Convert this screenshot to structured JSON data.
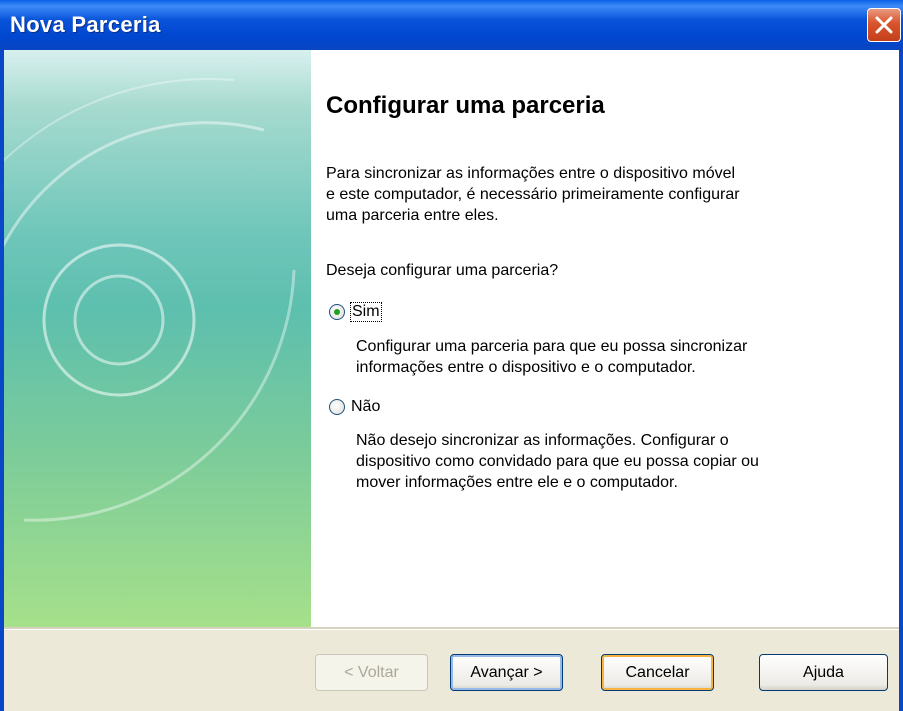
{
  "window": {
    "title": "Nova Parceria"
  },
  "page": {
    "heading": "Configurar uma parceria",
    "paragraph_lines": [
      "Para sincronizar as informações entre o dispositivo móvel",
      "e este computador, é necessário primeiramente configurar",
      "uma parceria entre eles."
    ],
    "question": "Deseja configurar uma parceria?",
    "options": [
      {
        "label": "Sim",
        "checked": true,
        "description_lines": [
          "Configurar uma parceria para que eu possa sincronizar",
          "informações entre o dispositivo e o computador."
        ]
      },
      {
        "label": "Não",
        "checked": false,
        "description_lines": [
          "Não desejo sincronizar as informações. Configurar o",
          "dispositivo como convidado para que eu possa copiar ou",
          "mover informações entre ele e o computador."
        ]
      }
    ]
  },
  "buttons": {
    "back": "< Voltar",
    "next": "Avançar >",
    "cancel": "Cancelar",
    "help": "Ajuda"
  },
  "colors": {
    "titlebar": "#0054E3",
    "close": "#D9542C",
    "sidepanel_top": "#d8f0ef",
    "sidepanel_bottom": "#a6e08a",
    "radio_dot": "#21A121"
  },
  "icons": {
    "close": "close-icon"
  }
}
